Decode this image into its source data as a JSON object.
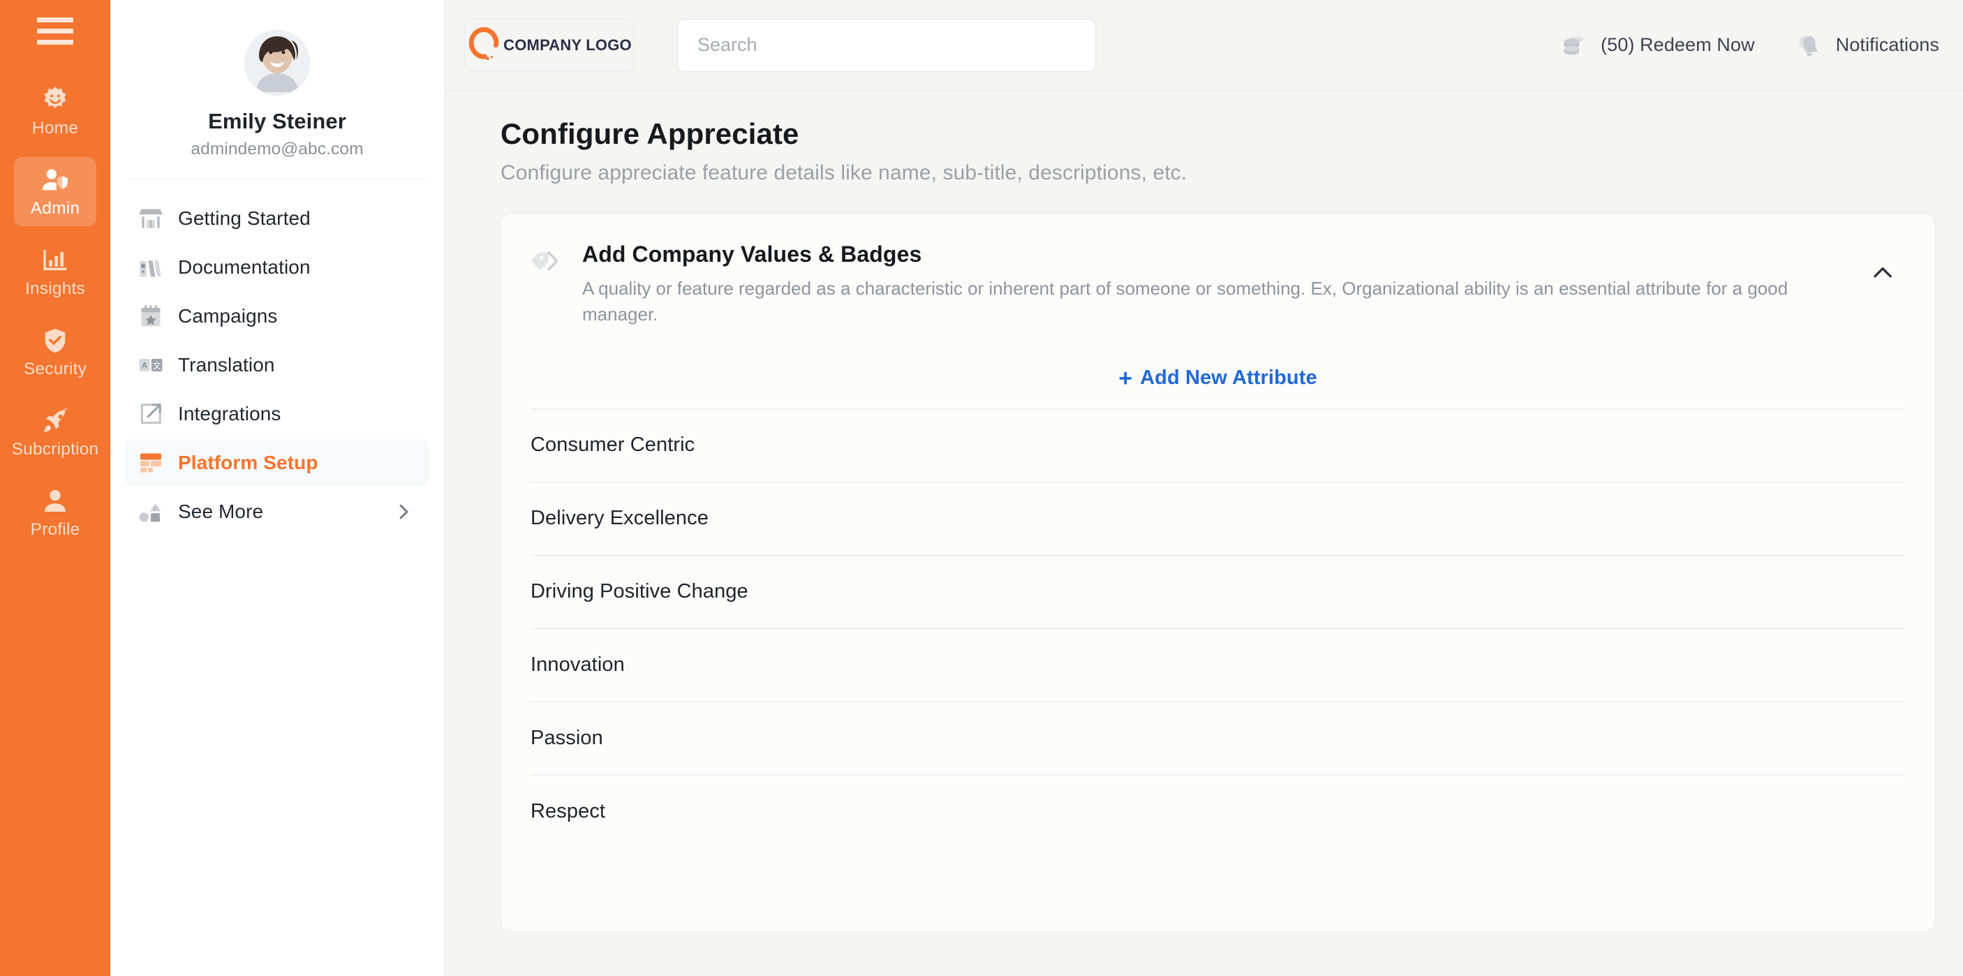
{
  "rail": {
    "menu_icon": "hamburger-icon",
    "items": [
      {
        "label": "Home",
        "icon": "sun-smile-icon",
        "active": false
      },
      {
        "label": "Admin",
        "icon": "user-shield-icon",
        "active": true
      },
      {
        "label": "Insights",
        "icon": "bar-chart-icon",
        "active": false
      },
      {
        "label": "Security",
        "icon": "shield-check-icon",
        "active": false
      },
      {
        "label": "Subcription",
        "icon": "rocket-icon",
        "active": false
      },
      {
        "label": "Profile",
        "icon": "user-icon",
        "active": false
      }
    ]
  },
  "sidebar": {
    "user": {
      "name": "Emily Steiner",
      "email": "admindemo@abc.com",
      "avatar": "user-avatar"
    },
    "items": [
      {
        "label": "Getting Started",
        "icon": "storefront-icon",
        "active": false,
        "chevron": false
      },
      {
        "label": "Documentation",
        "icon": "books-icon",
        "active": false,
        "chevron": false
      },
      {
        "label": "Campaigns",
        "icon": "calendar-star-icon",
        "active": false,
        "chevron": false
      },
      {
        "label": "Translation",
        "icon": "translate-icon",
        "active": false,
        "chevron": false
      },
      {
        "label": "Integrations",
        "icon": "external-link-icon",
        "active": false,
        "chevron": false
      },
      {
        "label": "Platform Setup",
        "icon": "wall-bricks-icon",
        "active": true,
        "chevron": false
      },
      {
        "label": "See More",
        "icon": "shapes-icon",
        "active": false,
        "chevron": true
      }
    ]
  },
  "topbar": {
    "logo_text": "COMPANY LOGO",
    "logo_icon": "company-c-logo",
    "search": {
      "value": "",
      "placeholder": "Search"
    },
    "redeem": {
      "count_label": "(50)",
      "label": "Redeem Now",
      "icon": "coins-icon"
    },
    "notifications": {
      "label": "Notifications",
      "icon": "bell-icon"
    }
  },
  "page": {
    "title": "Configure Appreciate",
    "subtitle": "Configure appreciate feature details like name, sub-title, descriptions, etc."
  },
  "card": {
    "icon": "tags-icon",
    "title": "Add Company Values & Badges",
    "description": "A quality or feature regarded as a characteristic or inherent part of someone or something. Ex, Organizational ability is an essential attribute for a good manager.",
    "collapse_icon": "chevron-up-icon",
    "add_button": {
      "plus": "+",
      "label": "Add New Attribute"
    },
    "attributes": [
      "Consumer Centric",
      "Delivery Excellence",
      "Driving Positive Change",
      "Innovation",
      "Passion",
      "Respect"
    ]
  },
  "colors": {
    "brand_orange": "#F4752F",
    "accent_blue": "#2368D4",
    "page_bg": "#F5F5F3",
    "card_bg": "#FCFCFB"
  }
}
